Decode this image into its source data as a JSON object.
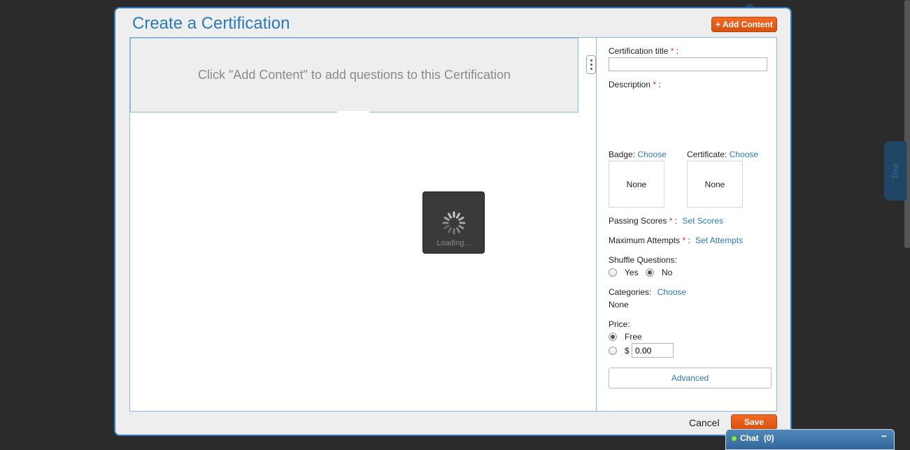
{
  "dialog": {
    "title": "Create a Certification",
    "add_content_label": "+ Add Content",
    "placeholder_text": "Click \"Add Content\" to add questions to this Certification",
    "loading_text": "Loading...",
    "cancel_label": "Cancel",
    "save_label": "Save"
  },
  "form": {
    "title_label": "Certification title",
    "required_marker": "*",
    "colon": ":",
    "title_value": "",
    "description_label": "Description",
    "badge_label": "Badge:",
    "badge_link": "Choose",
    "badge_value": "None",
    "certificate_label": "Certificate:",
    "certificate_link": "Choose",
    "certificate_value": "None",
    "passing_label": "Passing Scores",
    "passing_link": "Set Scores",
    "attempts_label": "Maximum Attempts",
    "attempts_link": "Set Attempts",
    "shuffle_label": "Shuffle Questions:",
    "shuffle_yes": "Yes",
    "shuffle_no": "No",
    "shuffle_selected": "No",
    "categories_label": "Categories:",
    "categories_link": "Choose",
    "categories_value": "None",
    "price_label": "Price:",
    "price_free": "Free",
    "price_currency": "$",
    "price_value": "0.00",
    "price_selected": "Free",
    "advanced_label": "Advanced"
  },
  "tour_label": "Tour",
  "chat": {
    "label": "Chat",
    "count": "(0)",
    "minimize": "−"
  },
  "colors": {
    "accent": "#2a7ab8",
    "button_orange": "#e85f19",
    "required": "#d42d2d"
  }
}
